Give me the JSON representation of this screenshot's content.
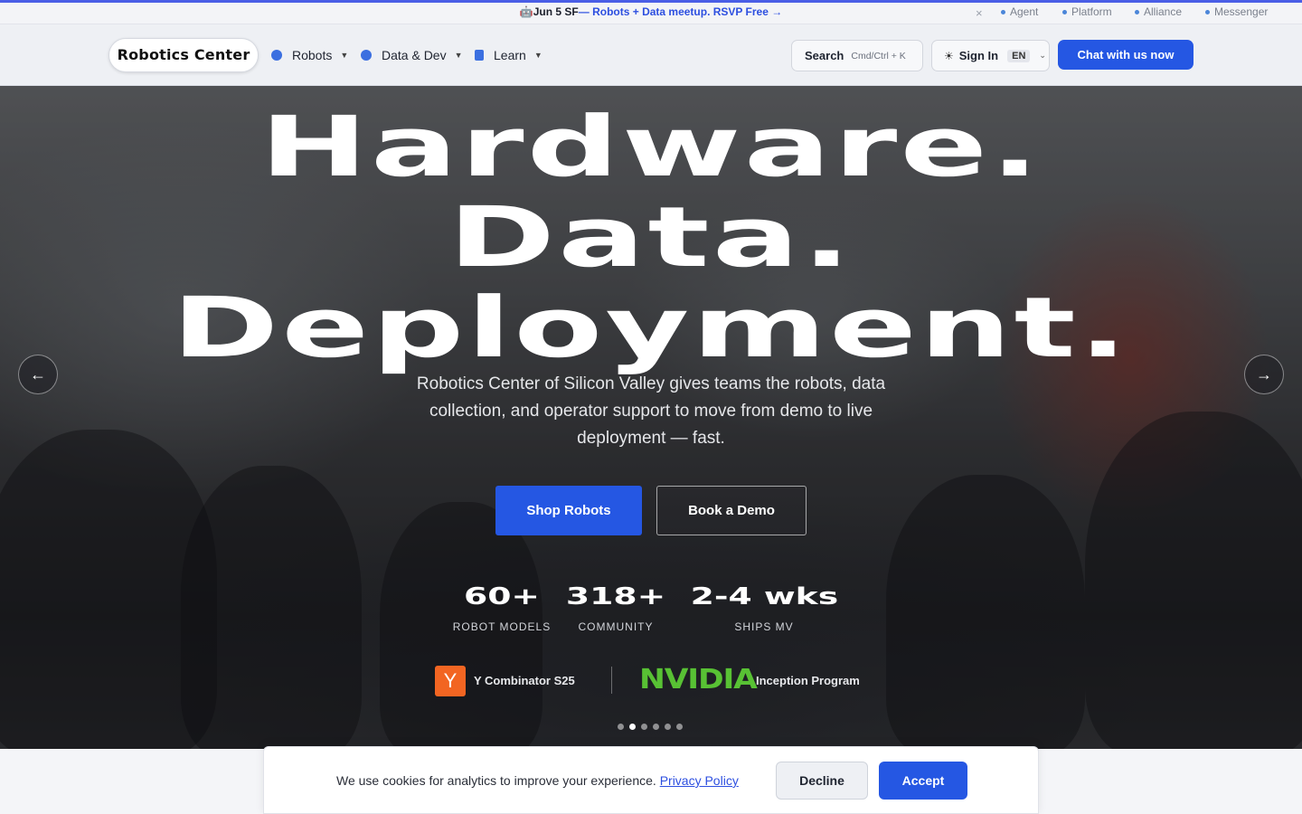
{
  "announcement": {
    "icon": "🤖",
    "date": "Jun 5 SF",
    "link_text": "— Robots + Data meetup. RSVP Free →",
    "close_icon": "×",
    "external_links": [
      "Agent",
      "Platform",
      "Alliance",
      "Messenger"
    ]
  },
  "nav": {
    "logo": "Robotics Center",
    "menu": [
      {
        "label": "Robots",
        "icon": "compass-icon"
      },
      {
        "label": "Data & Dev",
        "icon": "compass-icon"
      },
      {
        "label": "Learn",
        "icon": "book-icon"
      }
    ],
    "search_label": "Search",
    "search_shortcut": "Cmd/Ctrl + K",
    "signin_label": "Sign In",
    "language": "EN",
    "chat_label": "Chat with us now"
  },
  "hero": {
    "headline": [
      "Hardware.",
      "Data.",
      "Deployment."
    ],
    "subtitle": "Robotics Center of Silicon Valley gives teams the robots, data collection, and operator support to move from demo to live deployment — fast.",
    "primary_cta": "Shop Robots",
    "secondary_cta": "Book a Demo",
    "stats": [
      {
        "value": "60+",
        "label": "ROBOT MODELS"
      },
      {
        "value": "318+",
        "label": "COMMUNITY"
      },
      {
        "value": "2-4 wks",
        "label": "SHIPS MV"
      }
    ],
    "badges": {
      "yc_logo": "Y",
      "yc_text": "Y Combinator S25",
      "nvidia_logo": "NVIDIA",
      "nvidia_text": "Inception Program"
    },
    "prev_arrow": "←",
    "next_arrow": "→",
    "slides_total": 6,
    "slide_active": 2
  },
  "cookie": {
    "message": "We use cookies for analytics to improve your experience.",
    "policy_link": "Privacy Policy",
    "decline": "Decline",
    "accept": "Accept"
  },
  "colors": {
    "accent": "#2557e3",
    "nvidia_green": "#58c134",
    "yc_orange": "#f26522"
  }
}
